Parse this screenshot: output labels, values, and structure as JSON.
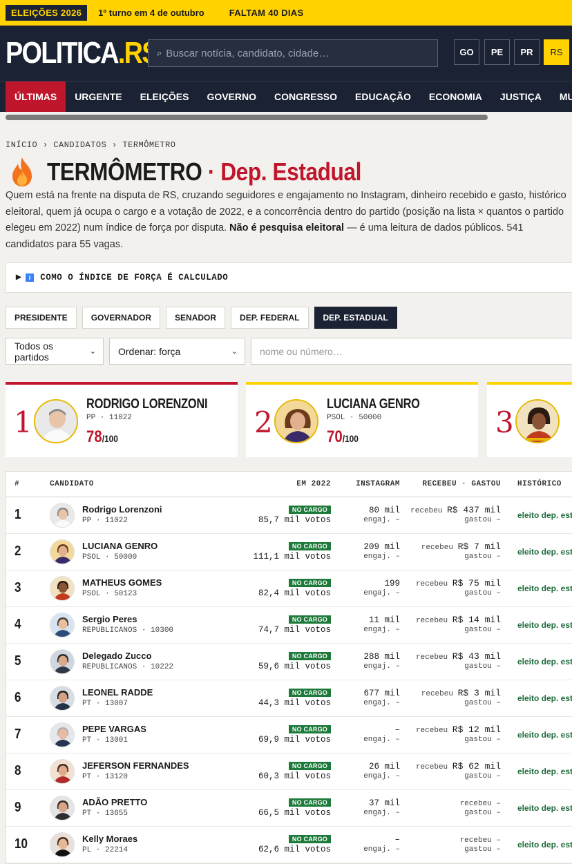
{
  "topbar": {
    "tag": "ELEIÇÕES 2026",
    "first_round": "1º turno em 4 de outubro",
    "countdown": "FALTAM 40 DIAS"
  },
  "header": {
    "logo_main": "POLITICA",
    "logo_dot": ".",
    "logo_suffix": "RS",
    "search_placeholder": "Buscar notícia, candidato, cidade…",
    "states": [
      "GO",
      "PE",
      "PR",
      "RS"
    ],
    "active_state": "RS"
  },
  "nav": [
    "ÚLTIMAS",
    "URGENTE",
    "ELEIÇÕES",
    "GOVERNO",
    "CONGRESSO",
    "EDUCAÇÃO",
    "ECONOMIA",
    "JUSTIÇA",
    "MUNICÍPIOS"
  ],
  "breadcrumb": "INÍCIO › CANDIDATOS › TERMÔMETRO",
  "page": {
    "title_main": "TERMÔMETRO",
    "title_sep": " · ",
    "title_sub": "Dep. Estadual",
    "desc_1": "Quem está na frente na disputa de RS, cruzando seguidores e engajamento no Instagram, dinheiro recebido e gasto, histórico eleitoral, quem já ocupa o cargo e a votação de 2022, e a concorrência dentro do partido (posição na lista × quantos o partido elegeu em 2022) num índice de força por disputa. ",
    "desc_bold": "Não é pesquisa eleitoral",
    "desc_2": " — é uma leitura de dados públicos. 541 candidatos para 55 vagas."
  },
  "details_label": "COMO O ÍNDICE DE FORÇA É CALCULADO",
  "tabs": [
    "PRESIDENTE",
    "GOVERNADOR",
    "SENADOR",
    "DEP. FEDERAL",
    "DEP. ESTADUAL"
  ],
  "active_tab": "DEP. ESTADUAL",
  "filters": {
    "party": "Todos os partidos",
    "order": "Ordenar: força",
    "search_placeholder": "nome ou número…"
  },
  "top_cards": [
    {
      "rank": "1",
      "name": "RODRIGO LORENZONI",
      "party_line": "PP · 11022",
      "score": "78",
      "max": "/100"
    },
    {
      "rank": "2",
      "name": "LUCIANA GENRO",
      "party_line": "PSOL · 50000",
      "score": "70",
      "max": "/100"
    },
    {
      "rank": "3",
      "name": "",
      "party_line": "",
      "score": "",
      "max": ""
    }
  ],
  "table": {
    "headers": {
      "pos": "#",
      "candidate": "CANDIDATO",
      "y2022": "EM 2022",
      "instagram": "INSTAGRAM",
      "money": "RECEBEU · GASTOU",
      "history": "HISTÓRICO"
    },
    "rows": [
      {
        "pos": "1",
        "name": "Rodrigo Lorenzoni",
        "party": "PP · 11022",
        "badge": "NO CARGO",
        "votes": "85,7 mil votos",
        "ig": "80 mil",
        "eng": "engaj. –",
        "rec_label": "recebeu",
        "rec_val": "R$ 437 mil",
        "gasto": "gastou –",
        "history": "eleito dep. estadual"
      },
      {
        "pos": "2",
        "name": "LUCIANA GENRO",
        "party": "PSOL · 50000",
        "badge": "NO CARGO",
        "votes": "111,1 mil votos",
        "ig": "209 mil",
        "eng": "engaj. –",
        "rec_label": "recebeu",
        "rec_val": "R$ 7 mil",
        "gasto": "gastou –",
        "history": "eleito dep. estadual"
      },
      {
        "pos": "3",
        "name": "MATHEUS GOMES",
        "party": "PSOL · 50123",
        "badge": "NO CARGO",
        "votes": "82,4 mil votos",
        "ig": "199",
        "eng": "engaj. –",
        "rec_label": "recebeu",
        "rec_val": "R$ 75 mil",
        "gasto": "gastou –",
        "history": "eleito dep. estadual"
      },
      {
        "pos": "4",
        "name": "Sergio Peres",
        "party": "REPUBLICANOS · 10300",
        "badge": "NO CARGO",
        "votes": "74,7 mil votos",
        "ig": "11 mil",
        "eng": "engaj. –",
        "rec_label": "recebeu",
        "rec_val": "R$ 14 mil",
        "gasto": "gastou –",
        "history": "eleito dep. estadual"
      },
      {
        "pos": "5",
        "name": "Delegado Zucco",
        "party": "REPUBLICANOS · 10222",
        "badge": "NO CARGO",
        "votes": "59,6 mil votos",
        "ig": "288 mil",
        "eng": "engaj. –",
        "rec_label": "recebeu",
        "rec_val": "R$ 43 mil",
        "gasto": "gastou –",
        "history": "eleito dep. estadual"
      },
      {
        "pos": "6",
        "name": "LEONEL RADDE",
        "party": "PT · 13007",
        "badge": "NO CARGO",
        "votes": "44,3 mil votos",
        "ig": "677 mil",
        "eng": "engaj. –",
        "rec_label": "recebeu",
        "rec_val": "R$ 3 mil",
        "gasto": "gastou –",
        "history": "eleito dep. estadual"
      },
      {
        "pos": "7",
        "name": "PEPE VARGAS",
        "party": "PT · 13001",
        "badge": "NO CARGO",
        "votes": "69,9 mil votos",
        "ig": "–",
        "eng": "engaj. –",
        "rec_label": "recebeu",
        "rec_val": "R$ 12 mil",
        "gasto": "gastou –",
        "history": "eleito dep. estadual"
      },
      {
        "pos": "8",
        "name": "JEFERSON FERNANDES",
        "party": "PT · 13120",
        "badge": "NO CARGO",
        "votes": "60,3 mil votos",
        "ig": "26 mil",
        "eng": "engaj. –",
        "rec_label": "recebeu",
        "rec_val": "R$ 62 mil",
        "gasto": "gastou –",
        "history": "eleito dep. estadual"
      },
      {
        "pos": "9",
        "name": "ADÃO PRETTO",
        "party": "PT · 13655",
        "badge": "NO CARGO",
        "votes": "66,5 mil votos",
        "ig": "37 mil",
        "eng": "engaj. –",
        "rec_label": "recebeu –",
        "rec_val": "",
        "gasto": "gastou –",
        "history": "eleito dep. estadual"
      },
      {
        "pos": "10",
        "name": "Kelly Moraes",
        "party": "PL · 22214",
        "badge": "NO CARGO",
        "votes": "62,6 mil votos",
        "ig": "–",
        "eng": "engaj. –",
        "rec_label": "recebeu –",
        "rec_val": "",
        "gasto": "gastou –",
        "history": "eleito dep. estadual"
      }
    ]
  },
  "colors": {
    "brand_dark": "#1b2233",
    "accent_yellow": "#ffd200",
    "accent_red": "#c0162c",
    "badge_green": "#1d7a3a"
  }
}
